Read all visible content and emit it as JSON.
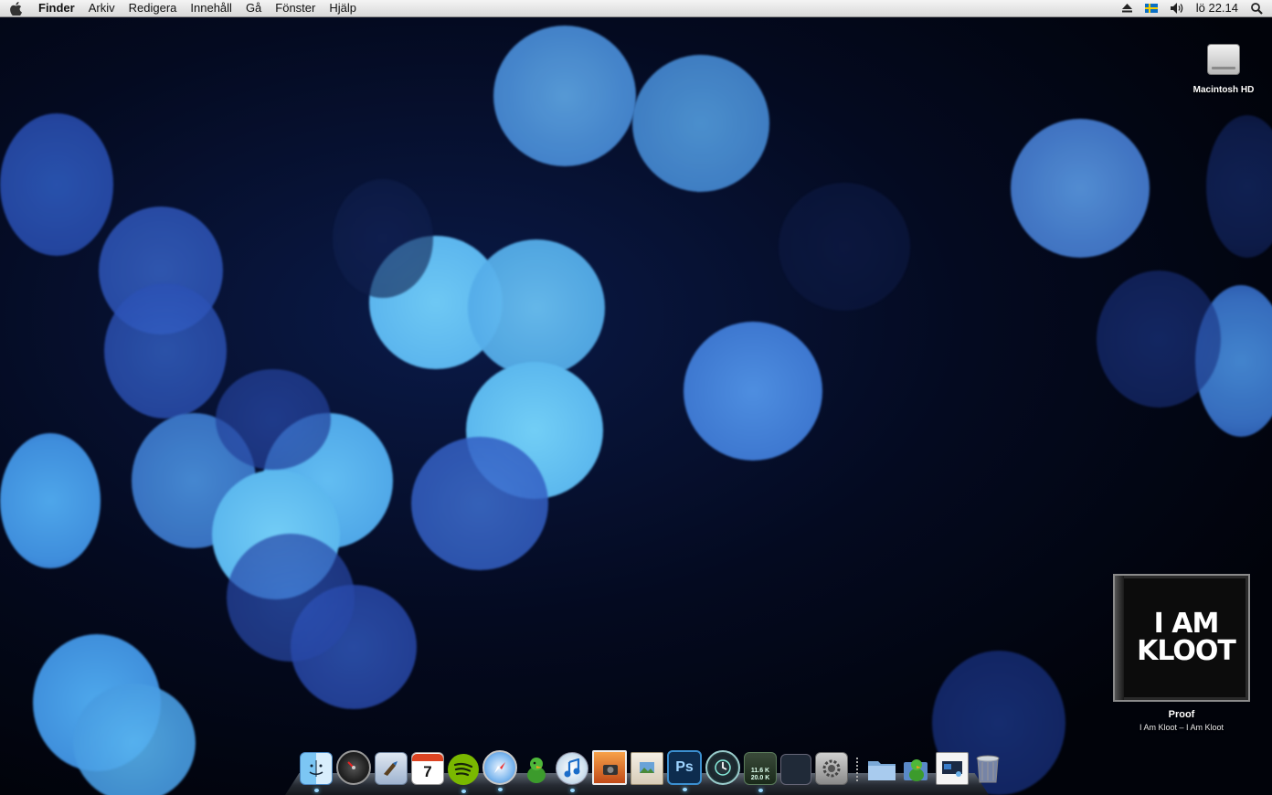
{
  "menubar": {
    "apple_icon": "apple-icon",
    "app_name": "Finder",
    "menus": [
      "Arkiv",
      "Redigera",
      "Innehåll",
      "Gå",
      "Fönster",
      "Hjälp"
    ],
    "status": {
      "eject_icon": "eject-icon",
      "input_flag_icon": "swedish-flag-icon",
      "volume_icon": "speaker-icon",
      "clock": "lö 22.14",
      "spotlight_icon": "magnifier-icon"
    }
  },
  "desktop": {
    "hd_label": "Macintosh HD"
  },
  "now_playing": {
    "album_art_text": "I AM\nKLOOT",
    "title": "Proof",
    "subtitle": "I Am Kloot – I Am Kloot"
  },
  "dock": {
    "meter_up": "11.6 K",
    "meter_down": "20.0 K",
    "calendar_day": "7",
    "apps": [
      {
        "name": "finder",
        "icon": "finder-icon",
        "running": true
      },
      {
        "name": "dashboard",
        "icon": "dashboard-icon",
        "running": false
      },
      {
        "name": "mail",
        "icon": "mail-icon",
        "running": false
      },
      {
        "name": "ical",
        "icon": "calendar-icon",
        "running": false
      },
      {
        "name": "spotify",
        "icon": "spotify-icon",
        "running": true
      },
      {
        "name": "safari",
        "icon": "safari-icon",
        "running": true
      },
      {
        "name": "adium",
        "icon": "adium-duck-icon",
        "running": false
      },
      {
        "name": "itunes",
        "icon": "itunes-icon",
        "running": true
      },
      {
        "name": "iphoto",
        "icon": "iphoto-icon",
        "running": false
      },
      {
        "name": "preview",
        "icon": "preview-icon",
        "running": false
      },
      {
        "name": "photoshop",
        "icon": "photoshop-icon",
        "running": true
      },
      {
        "name": "time-machine",
        "icon": "time-machine-icon",
        "running": false
      },
      {
        "name": "network-meter",
        "icon": "network-meter-icon",
        "running": true
      },
      {
        "name": "spaces",
        "icon": "spaces-icon",
        "running": false
      },
      {
        "name": "system-preferences",
        "icon": "system-preferences-icon",
        "running": false
      }
    ],
    "stacks": [
      {
        "name": "folder-stack",
        "icon": "folder-icon"
      },
      {
        "name": "applications-stack",
        "icon": "applications-stack-icon"
      },
      {
        "name": "screenshots-stack",
        "icon": "screenshot-icon"
      },
      {
        "name": "trash",
        "icon": "trash-icon"
      }
    ]
  },
  "colors": {
    "bokeh_light": "#4fb8f0",
    "bokeh_mid": "#3e8ad8",
    "bokeh_dark": "#2f56b8",
    "background": "#02040c"
  }
}
